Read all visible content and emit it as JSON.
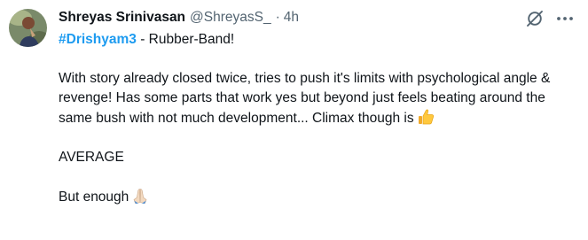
{
  "tweet": {
    "author": {
      "display_name": "Shreyas Srinivasan",
      "handle": "@ShreyasS_",
      "separator": "·",
      "timestamp": "4h"
    },
    "icons": {
      "avatar": "profile-photo",
      "grok": "grok-slash-circle-icon",
      "more": "more-horizontal-icon"
    },
    "hashtag": "#Drishyam3",
    "title_rest": " - Rubber-Band!",
    "paragraph1": "With story already closed twice, tries to push it's limits with psychological angle & revenge! Has some parts that work yes but beyond just feels beating around the same bush with not much development... Climax though is",
    "paragraph1_emoji": "thumbs-up-emoji",
    "paragraph2": "AVERAGE",
    "paragraph3": "But enough",
    "paragraph3_emoji": "folded-hands-emoji",
    "colors": {
      "text": "#0f1419",
      "secondary": "#536471",
      "link": "#1d9bf0",
      "thumb": "#ffc83d"
    }
  }
}
